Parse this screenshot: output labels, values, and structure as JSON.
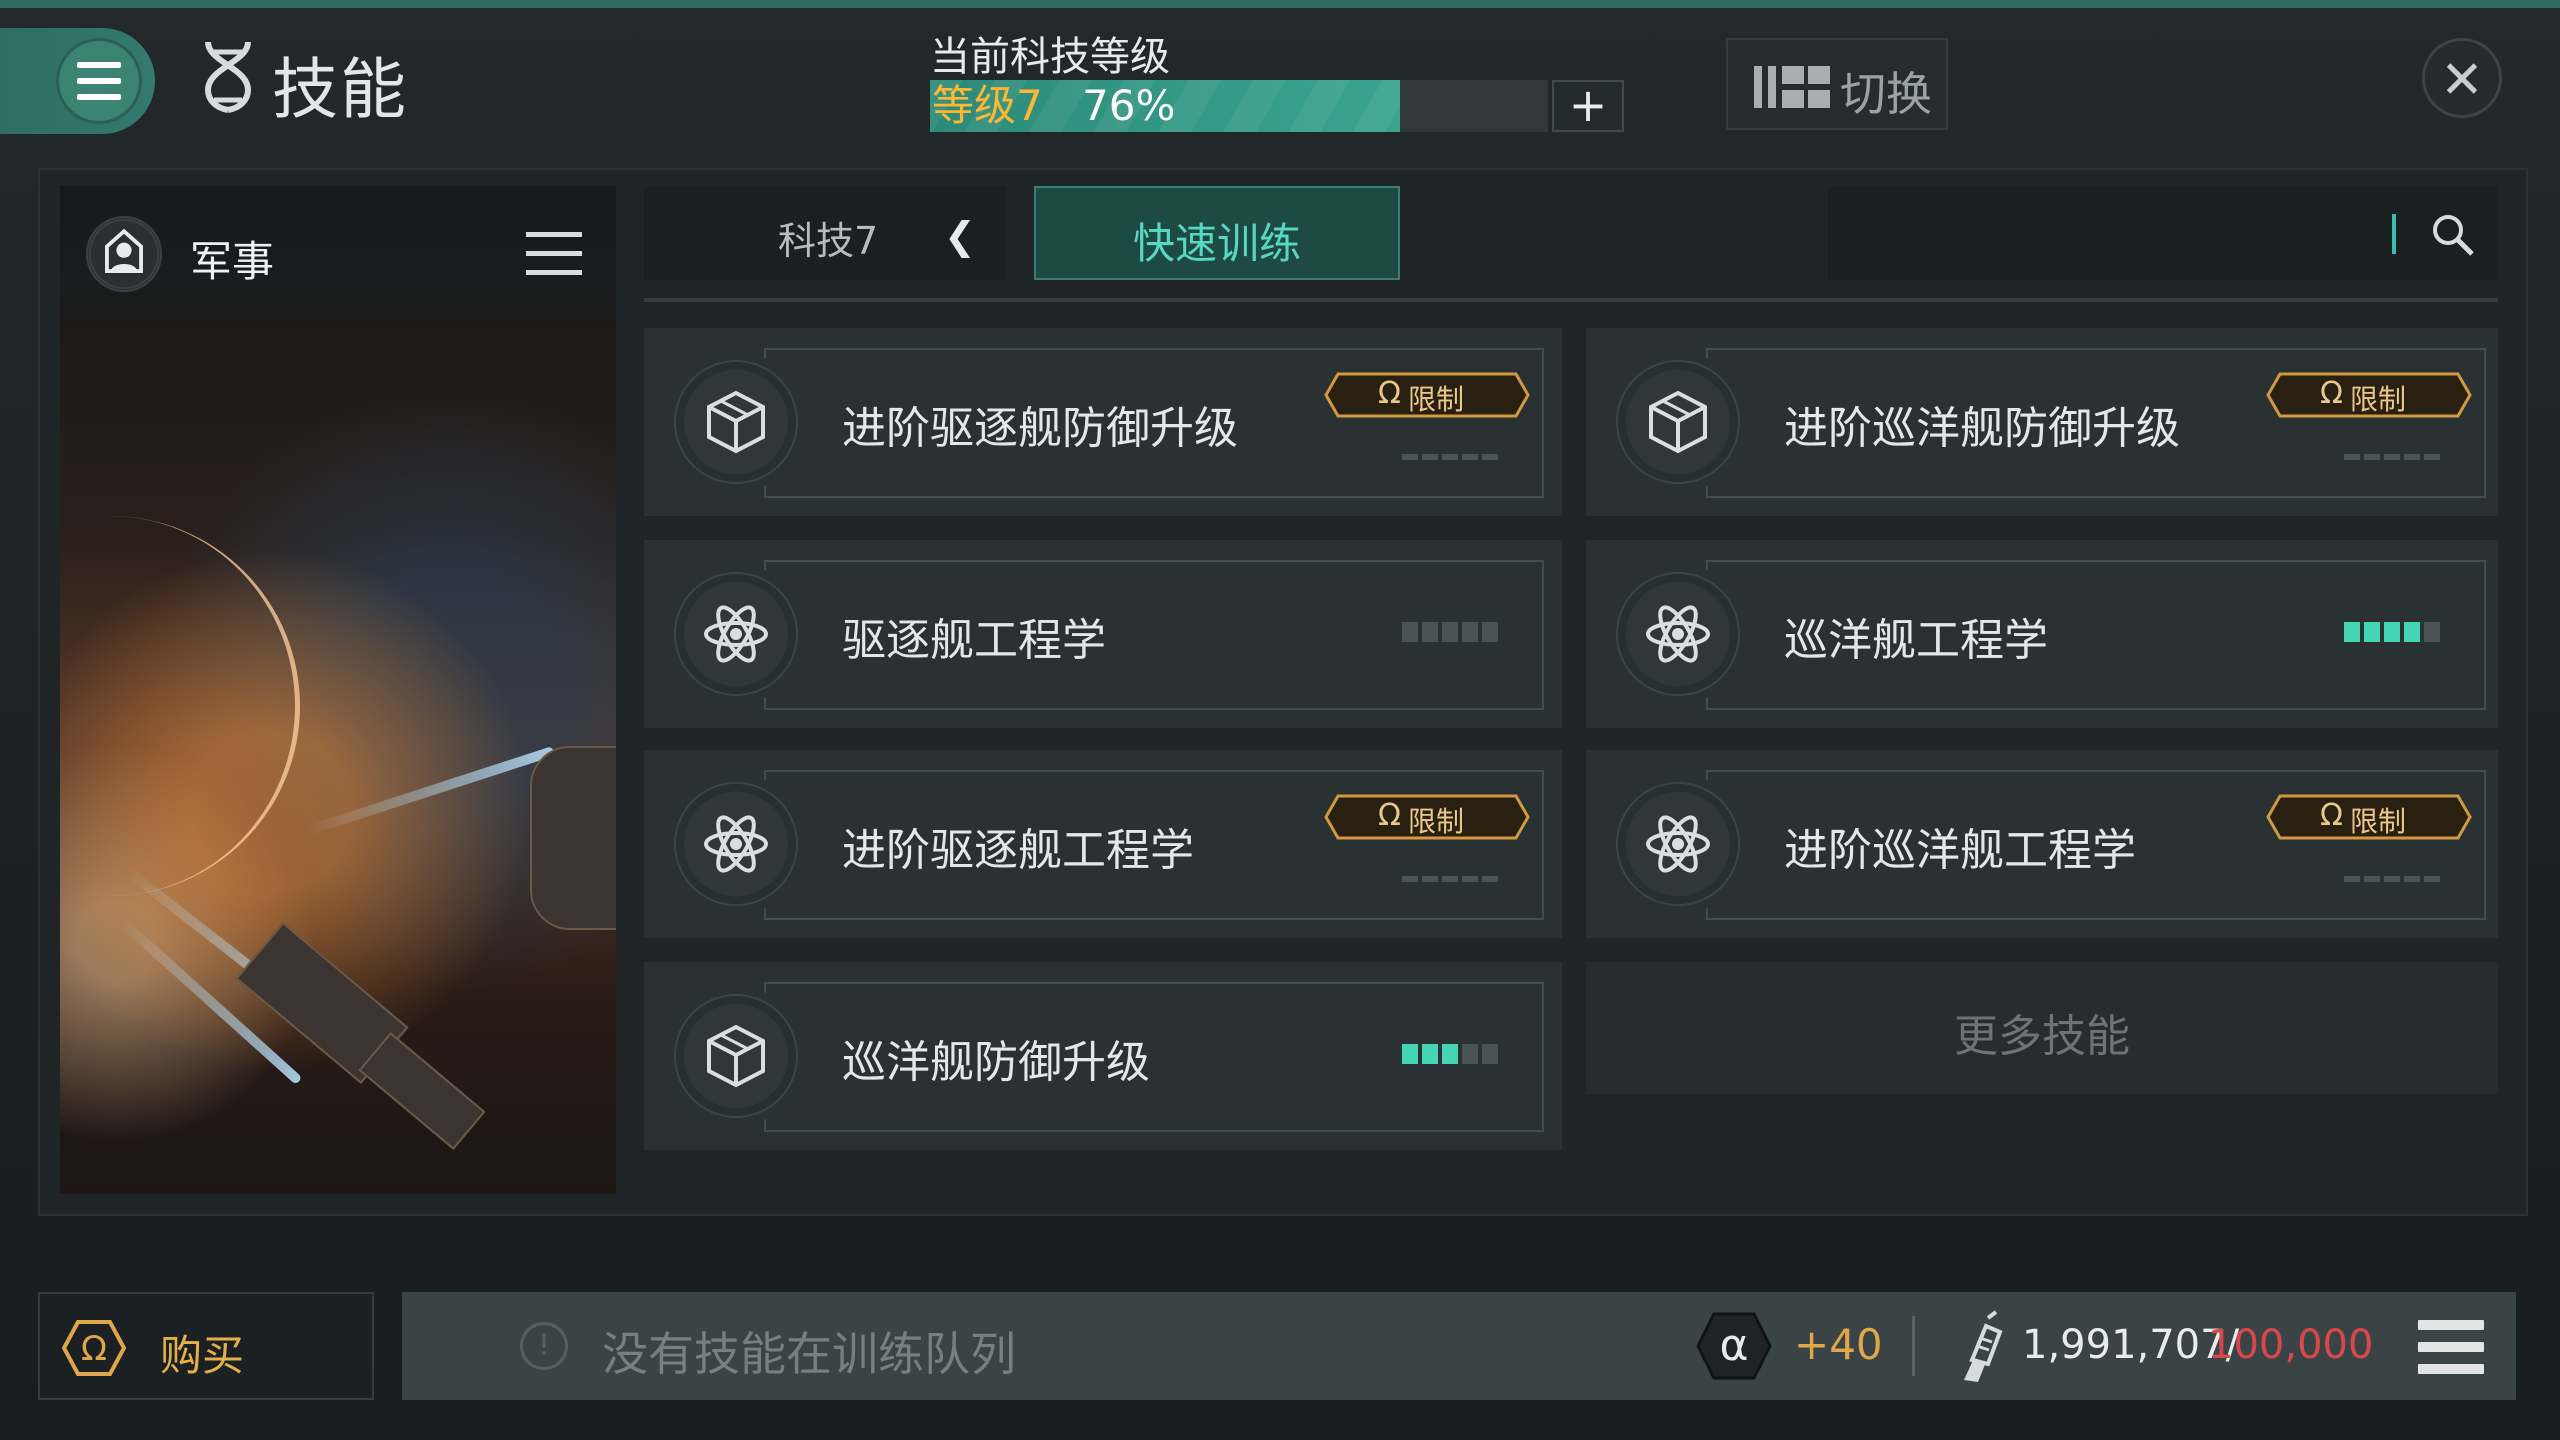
{
  "header": {
    "title": "技能",
    "tech_level_caption": "当前科技等级",
    "tech_level_label": "等级7",
    "tech_level_percent": "76%",
    "tech_level_progress": 0.76,
    "plus_label": "+",
    "switch_label": "切换"
  },
  "sidebar": {
    "category_label": "军事"
  },
  "tabs": {
    "tech_label": "科技7",
    "quick_train_label": "快速训练"
  },
  "search": {
    "placeholder": ""
  },
  "skills": [
    {
      "name": "进阶驱逐舰防御升级",
      "icon": "cube-icon",
      "restricted": true,
      "badge": "限制",
      "level": 0
    },
    {
      "name": "进阶巡洋舰防御升级",
      "icon": "cube-icon",
      "restricted": true,
      "badge": "限制",
      "level": 0
    },
    {
      "name": "驱逐舰工程学",
      "icon": "atom-icon",
      "restricted": false,
      "badge": "",
      "level": 0
    },
    {
      "name": "巡洋舰工程学",
      "icon": "atom-icon",
      "restricted": false,
      "badge": "",
      "level": 4
    },
    {
      "name": "进阶驱逐舰工程学",
      "icon": "atom-icon",
      "restricted": true,
      "badge": "限制",
      "level": 0
    },
    {
      "name": "进阶巡洋舰工程学",
      "icon": "atom-icon",
      "restricted": true,
      "badge": "限制",
      "level": 0
    },
    {
      "name": "巡洋舰防御升级",
      "icon": "cube-icon",
      "restricted": false,
      "badge": "",
      "level": 3
    }
  ],
  "more_skills_label": "更多技能",
  "bottom": {
    "buy_label": "购买",
    "queue_empty_text": "没有技能在训练队列",
    "alpha_bonus": "+40",
    "skill_points_current": "1,991,707/",
    "skill_points_max": "100,000"
  },
  "colors": {
    "accent_teal": "#44d5b5",
    "gold": "#e0a64a",
    "warning_red": "#d8484b"
  }
}
